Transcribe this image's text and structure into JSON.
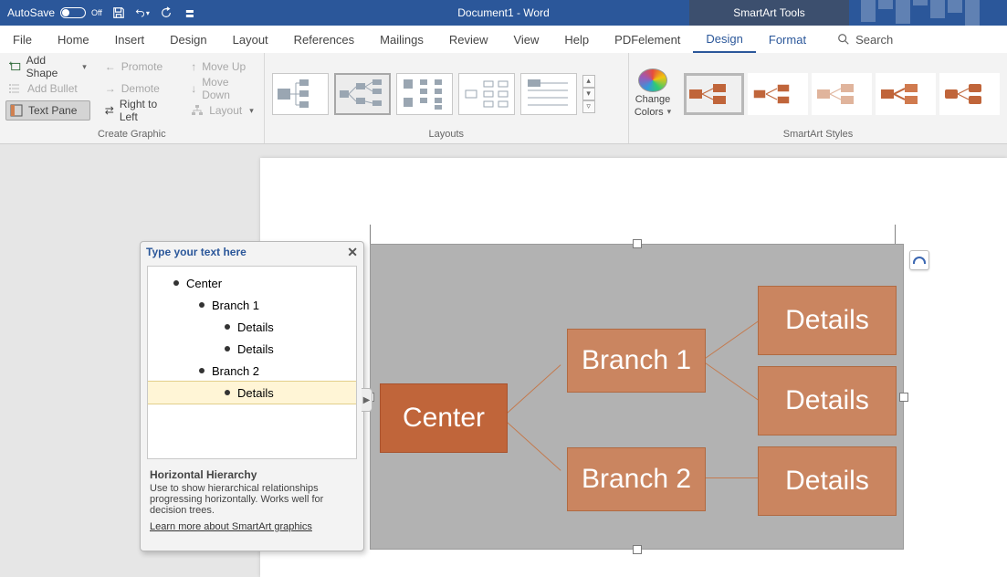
{
  "titlebar": {
    "autosave_label": "AutoSave",
    "autosave_state": "Off",
    "document_title": "Document1  -  Word",
    "tool_tab_title": "SmartArt Tools"
  },
  "tabs": {
    "file": "File",
    "home": "Home",
    "insert": "Insert",
    "design": "Design",
    "layout": "Layout",
    "references": "References",
    "mailings": "Mailings",
    "review": "Review",
    "view": "View",
    "help": "Help",
    "pdfelement": "PDFelement",
    "sa_design": "Design",
    "sa_format": "Format",
    "search_placeholder": "Search"
  },
  "ribbon": {
    "create_graphic": {
      "label": "Create Graphic",
      "add_shape": "Add Shape",
      "add_bullet": "Add Bullet",
      "text_pane": "Text Pane",
      "promote": "Promote",
      "demote": "Demote",
      "right_to_left": "Right to Left",
      "move_up": "Move Up",
      "move_down": "Move Down",
      "layout": "Layout"
    },
    "layouts": {
      "label": "Layouts"
    },
    "change_colors": {
      "line1": "Change",
      "line2": "Colors"
    },
    "styles": {
      "label": "SmartArt Styles"
    }
  },
  "textpane": {
    "header": "Type your text here",
    "items": {
      "center": "Center",
      "branch1": "Branch 1",
      "details1": "Details",
      "details2": "Details",
      "branch2": "Branch 2",
      "details3": "Details"
    },
    "desc_title": "Horizontal Hierarchy",
    "desc_body": "Use to show hierarchical relationships progressing horizontally. Works well for decision trees.",
    "desc_link": "Learn more about SmartArt graphics"
  },
  "smartart": {
    "center": "Center",
    "branch1": "Branch 1",
    "branch2": "Branch 2",
    "details1": "Details",
    "details2": "Details",
    "details3": "Details"
  }
}
